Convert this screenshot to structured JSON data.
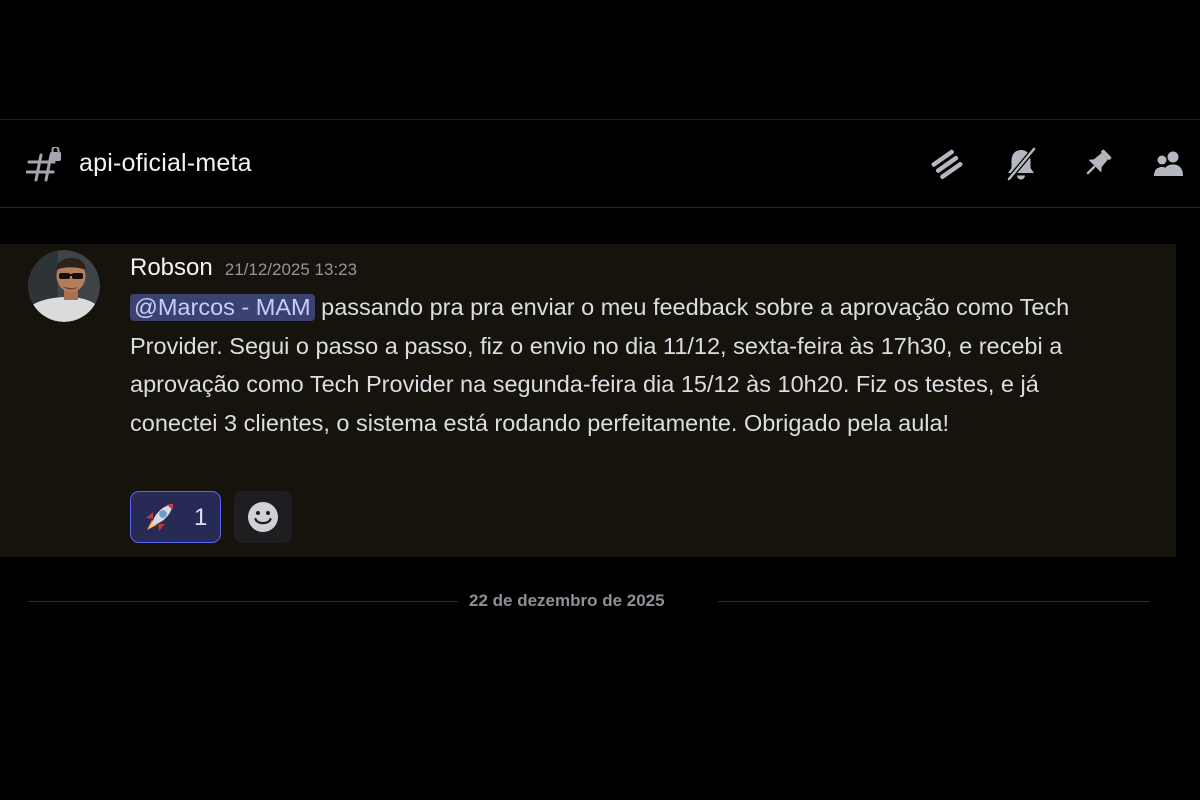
{
  "channel": {
    "name": "api-oficial-meta"
  },
  "toolbar": {
    "icons": [
      "threads-icon",
      "bell-muted-icon",
      "pin-icon",
      "members-icon"
    ]
  },
  "message": {
    "author": "Robson",
    "timestamp": "21/12/2025 13:23",
    "mention": "@Marcos - MAM",
    "text": " passando pra pra enviar o meu feedback sobre a aprovação como Tech Provider. Segui o passo a passo, fiz o envio no dia 11/12, sexta-feira às 17h30, e recebi a aprovação como Tech Provider na segunda-feira dia 15/12 às 10h20. Fiz os testes, e já conectei 3 clientes, o sistema está rodando perfeitamente. Obrigado pela aula!",
    "reactions": [
      {
        "emoji": "rocket-icon",
        "count": "1"
      }
    ],
    "add_reaction_icon": "smiley-face-icon",
    "highlight_color": "#15130c",
    "mention_color": "#3c4270"
  },
  "date_divider": "22 de dezembro de 2025",
  "colors": {
    "background": "#000000",
    "accent": "#5865f2",
    "text": "#dbdee1",
    "muted": "#94969c"
  }
}
